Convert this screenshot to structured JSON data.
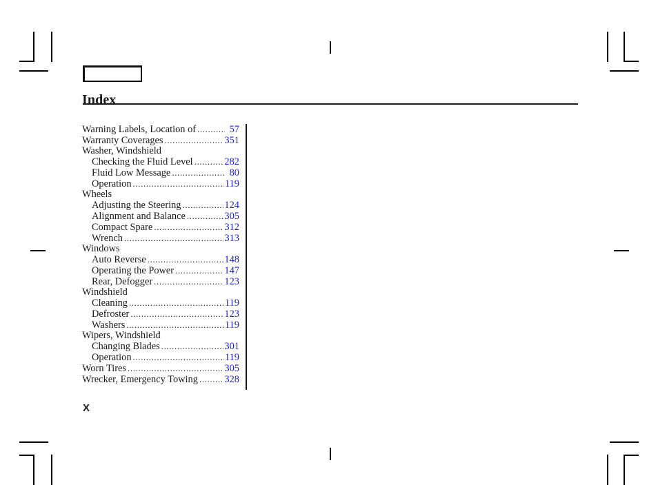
{
  "document": {
    "title": "Index",
    "footer_marker": "X",
    "page_number_color": "#2222cc",
    "text_color": "#1a1a1a"
  },
  "header": {
    "box_label": ""
  },
  "index": {
    "entries": [
      {
        "label": "Warning Labels, Location of",
        "page": "57",
        "level": 0
      },
      {
        "label": "Warranty Coverages",
        "page": "351",
        "level": 0
      },
      {
        "label": "Washer, Windshield",
        "page": "",
        "level": 0,
        "heading": true
      },
      {
        "label": "Checking the Fluid Level",
        "page": "282",
        "level": 1
      },
      {
        "label": "Fluid Low Message",
        "page": "80",
        "level": 1
      },
      {
        "label": "Operation",
        "page": "119",
        "level": 1
      },
      {
        "label": "Wheels",
        "page": "",
        "level": 0,
        "heading": true
      },
      {
        "label": "Adjusting the Steering",
        "page": "124",
        "level": 1
      },
      {
        "label": "Alignment and Balance",
        "page": "305",
        "level": 1
      },
      {
        "label": "Compact Spare",
        "page": "312",
        "level": 1
      },
      {
        "label": "Wrench",
        "page": "313",
        "level": 1
      },
      {
        "label": "Windows",
        "page": "",
        "level": 0,
        "heading": true
      },
      {
        "label": "Auto Reverse",
        "page": "148",
        "level": 1
      },
      {
        "label": "Operating the Power",
        "page": "147",
        "level": 1
      },
      {
        "label": "Rear, Defogger",
        "page": "123",
        "level": 1
      },
      {
        "label": "Windshield",
        "page": "",
        "level": 0,
        "heading": true
      },
      {
        "label": "Cleaning",
        "page": "119",
        "level": 1
      },
      {
        "label": "Defroster",
        "page": "123",
        "level": 1
      },
      {
        "label": "Washers",
        "page": "119",
        "level": 1
      },
      {
        "label": "Wipers, Windshield",
        "page": "",
        "level": 0,
        "heading": true
      },
      {
        "label": "Changing Blades",
        "page": "301",
        "level": 1
      },
      {
        "label": "Operation",
        "page": "119",
        "level": 1
      },
      {
        "label": "Worn Tires",
        "page": "305",
        "level": 0
      },
      {
        "label": "Wrecker, Emergency Towing",
        "page": "328",
        "level": 0
      }
    ]
  },
  "crop_marks": {
    "description": "printer registration and trim marks",
    "corners": [
      "top-left",
      "top-right",
      "bottom-left",
      "bottom-right"
    ],
    "center_ticks": [
      "top-center",
      "bottom-center",
      "left-middle",
      "right-middle"
    ]
  }
}
